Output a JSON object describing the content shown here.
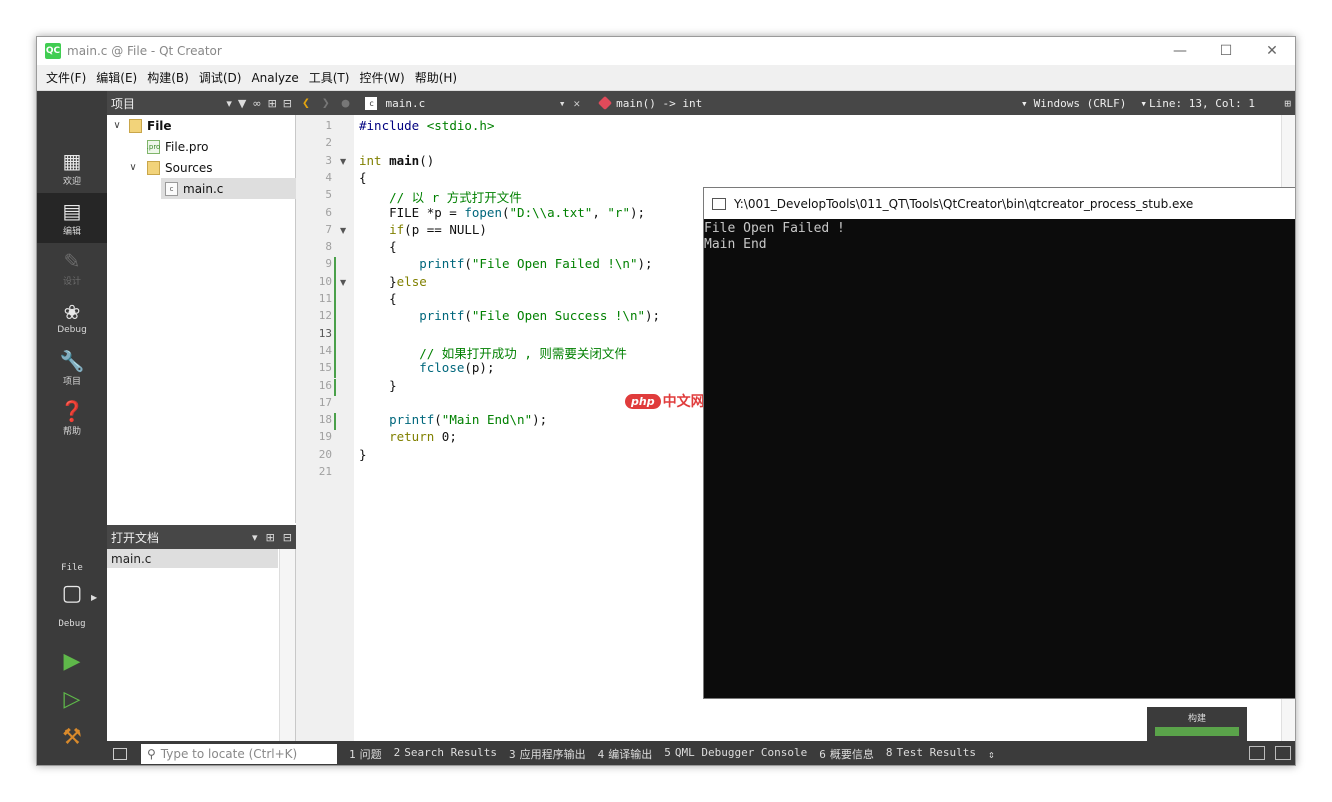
{
  "window": {
    "title": "main.c @ File - Qt Creator",
    "logo": "QC"
  },
  "menu": [
    "文件(F)",
    "编辑(E)",
    "构建(B)",
    "调试(D)",
    "Analyze",
    "工具(T)",
    "控件(W)",
    "帮助(H)"
  ],
  "modes": [
    {
      "label": "欢迎",
      "icon": "grid-icon"
    },
    {
      "label": "编辑",
      "icon": "edit-doc-icon"
    },
    {
      "label": "设计",
      "icon": "pencil-icon"
    },
    {
      "label": "Debug",
      "icon": "bug-icon"
    },
    {
      "label": "项目",
      "icon": "wrench-icon"
    },
    {
      "label": "帮助",
      "icon": "help-icon"
    }
  ],
  "kit": {
    "project": "File",
    "build": "Debug"
  },
  "project_pane": {
    "title": "项目",
    "tree": [
      {
        "label": "File",
        "level": 0,
        "kind": "folder"
      },
      {
        "label": "File.pro",
        "level": 1,
        "kind": "pro"
      },
      {
        "label": "Sources",
        "level": 1,
        "kind": "folder"
      },
      {
        "label": "main.c",
        "level": 2,
        "kind": "c"
      }
    ]
  },
  "open_docs": {
    "title": "打开文档",
    "items": [
      "main.c"
    ]
  },
  "editor_toolbar": {
    "file": "main.c",
    "function": "main() -> int",
    "line_ending": "Windows (CRLF)",
    "cursor": "Line: 13, Col: 1"
  },
  "code_lines": [
    "#include <stdio.h>",
    "",
    "int main()",
    "{",
    "    // 以 r 方式打开文件",
    "    FILE *p = fopen(\"D:\\\\a.txt\", \"r\");",
    "    if(p == NULL)",
    "    {",
    "        printf(\"File Open Failed !\\n\");",
    "    }else",
    "    {",
    "        printf(\"File Open Success !\\n\");",
    "",
    "        // 如果打开成功 , 则需要关闭文件",
    "        fclose(p);",
    "    }",
    "",
    "    printf(\"Main End\\n\");",
    "    return 0;",
    "}",
    ""
  ],
  "console": {
    "title": "Y:\\001_DevelopTools\\011_QT\\Tools\\QtCreator\\bin\\qtcreator_process_stub.exe",
    "lines": [
      "File Open Failed !",
      "Main End"
    ]
  },
  "watermark": {
    "badge": "php",
    "text": "中文网"
  },
  "build_progress": {
    "label": "构建",
    "fraction": 1.0
  },
  "statusbar": {
    "locator_placeholder": "Type to locate (Ctrl+K)",
    "tabs": [
      {
        "num": "1",
        "label": "问题"
      },
      {
        "num": "2",
        "label": "Search Results"
      },
      {
        "num": "3",
        "label": "应用程序输出"
      },
      {
        "num": "4",
        "label": "编译输出"
      },
      {
        "num": "5",
        "label": "QML Debugger Console"
      },
      {
        "num": "6",
        "label": "概要信息"
      },
      {
        "num": "8",
        "label": "Test Results"
      }
    ]
  }
}
